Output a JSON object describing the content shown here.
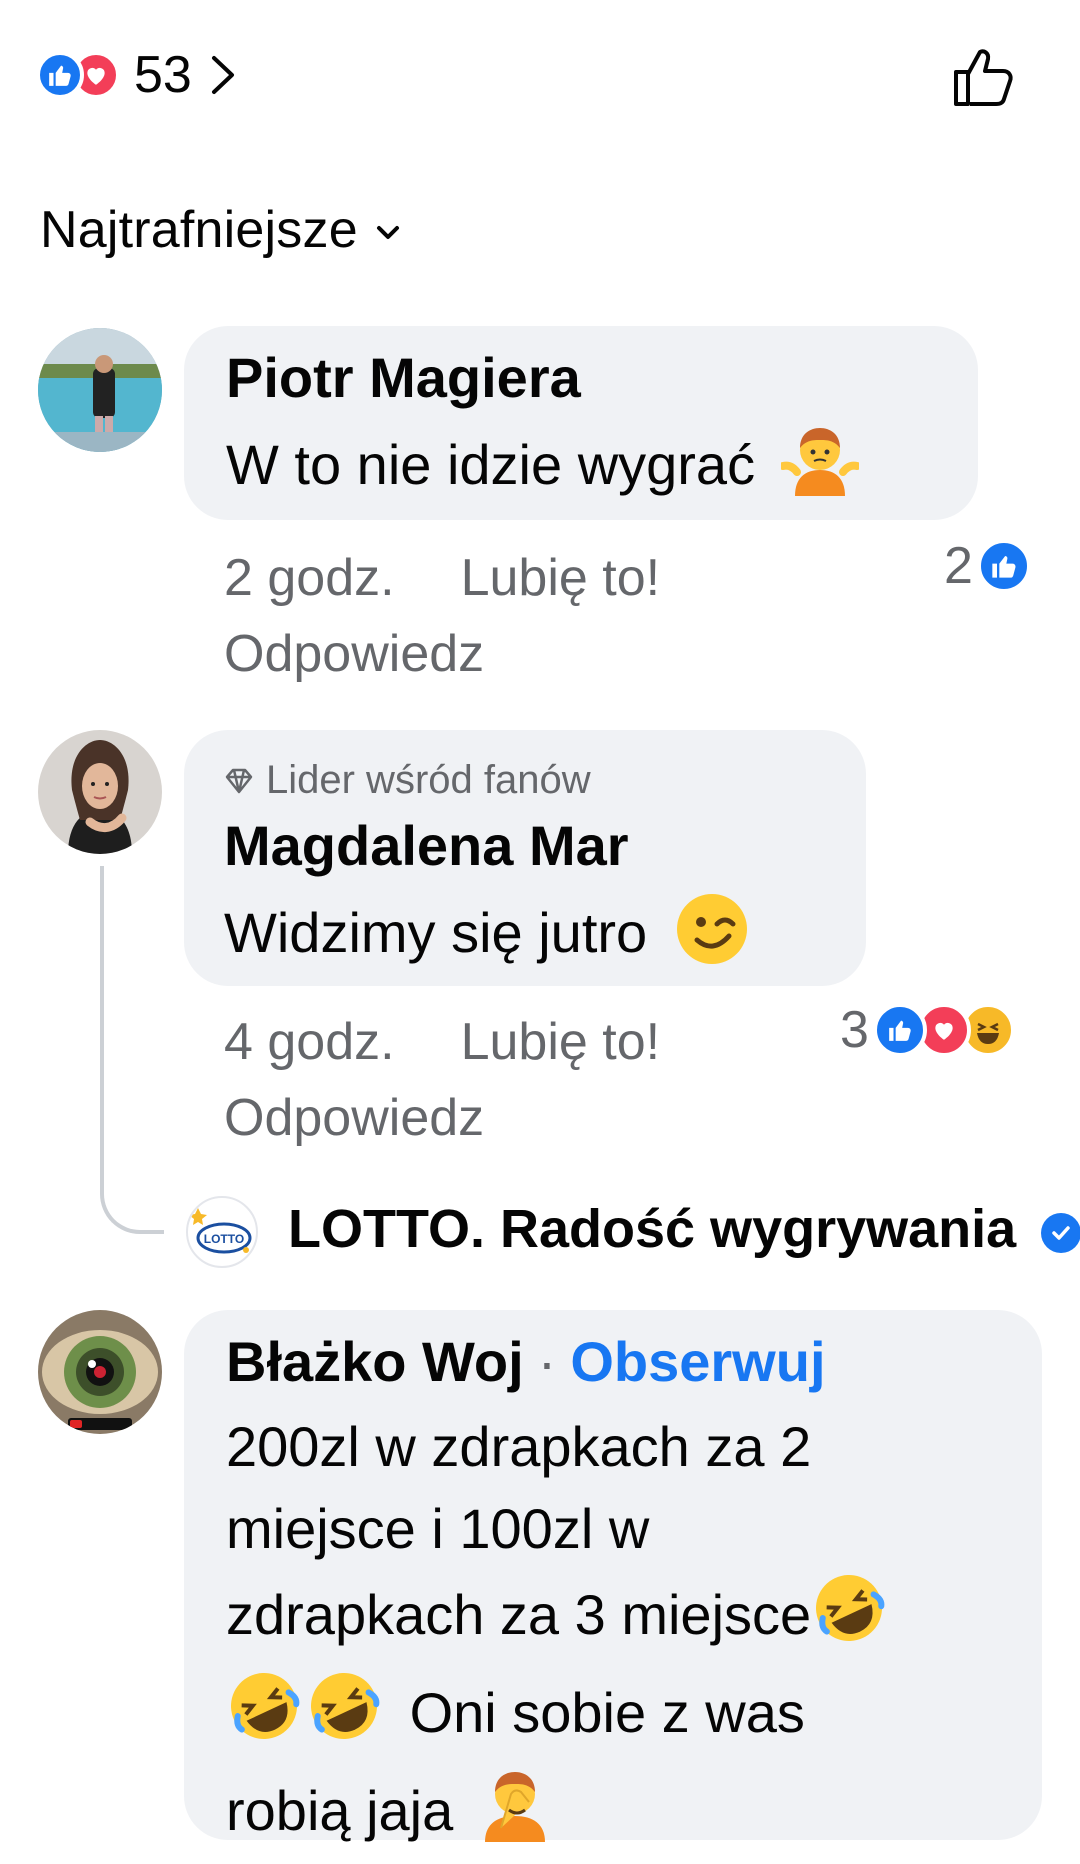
{
  "reactions_summary": {
    "count": "53",
    "icons": [
      "like-icon",
      "love-icon"
    ]
  },
  "sort": {
    "label": "Najtrafniejsze"
  },
  "comments": [
    {
      "author": "Piotr Magiera",
      "text": "W to nie idzie wygrać",
      "emoji": "person-shrugging",
      "time": "2 godz.",
      "like_label": "Lubię to!",
      "reply_label": "Odpowiedz",
      "reaction_count": "2",
      "reaction_icons": [
        "like-icon"
      ]
    },
    {
      "badge": "Lider wśród fanów",
      "author": "Magdalena Mar",
      "text": "Widzimy się jutro",
      "emoji": "winking-face",
      "time": "4 godz.",
      "like_label": "Lubię to!",
      "reply_label": "Odpowiedz",
      "reaction_count": "3",
      "reaction_icons": [
        "like-icon",
        "love-icon",
        "haha-icon"
      ]
    },
    {
      "author": "Błażko Woj",
      "follow_label": "Obserwuj",
      "text_line1": "200zl w zdrapkach za 2",
      "text_line2": "miejsce i 100zl w",
      "text_line3": "zdrapkach za 3 miejsce",
      "text_line4": "Oni sobie z was",
      "text_line5": "robią jaja",
      "emojis": [
        "rolling-on-floor-laughing",
        "rolling-on-floor-laughing",
        "rolling-on-floor-laughing",
        "person-facepalming"
      ]
    }
  ],
  "reply": {
    "page_name": "LOTTO. Radość wygrywania",
    "logo_text": "LOTTO",
    "verified": true
  },
  "colors": {
    "like_blue": "#1877f2",
    "love_red": "#f33e58",
    "haha_yellow": "#f7b928",
    "bubble_gray": "#f0f2f5",
    "meta_gray": "#65676b"
  }
}
